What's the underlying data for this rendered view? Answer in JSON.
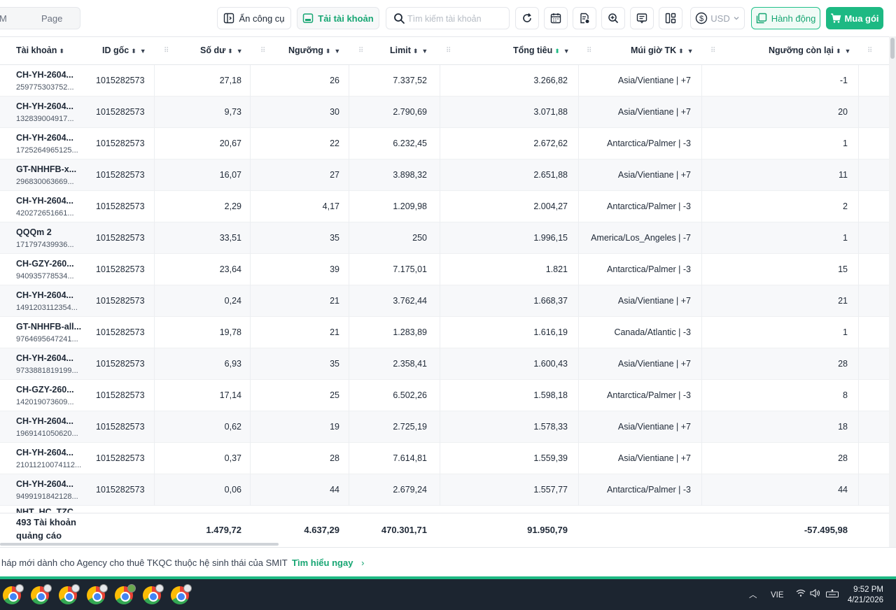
{
  "toolbar": {
    "page_prefix": "M",
    "page_label": "Page",
    "hide_tools_label": "Ẩn công cụ",
    "ad_account_label": "Tải tài khoản",
    "search_placeholder": "Tìm kiếm tài khoản",
    "currency_label": "USD",
    "actions_label": "Hành động",
    "buy_label": "Mua gói",
    "accent_color": "#1db983"
  },
  "table": {
    "columns": [
      "Tài khoản",
      "ID gốc",
      "Số dư",
      "Ngưỡng",
      "Limit",
      "Tổng tiêu",
      "Múi giờ TK",
      "Ngưỡng còn lại"
    ],
    "rows": [
      {
        "name": "CH-YH-2604...",
        "sub": "259775303752...",
        "root_id": "1015282573",
        "balance": "27,18",
        "threshold": "26",
        "limit": "7.337,52",
        "total_spend": "3.266,82",
        "timezone": "Asia/Vientiane | +7",
        "remaining": "-1"
      },
      {
        "name": "CH-YH-2604...",
        "sub": "132839004917...",
        "root_id": "1015282573",
        "balance": "9,73",
        "threshold": "30",
        "limit": "2.790,69",
        "total_spend": "3.071,88",
        "timezone": "Asia/Vientiane | +7",
        "remaining": "20"
      },
      {
        "name": "CH-YH-2604...",
        "sub": "1725264965125...",
        "root_id": "1015282573",
        "balance": "20,67",
        "threshold": "22",
        "limit": "6.232,45",
        "total_spend": "2.672,62",
        "timezone": "Antarctica/Palmer | -3",
        "remaining": "1"
      },
      {
        "name": "GT-NHHFB-x...",
        "sub": "296830063669...",
        "root_id": "1015282573",
        "balance": "16,07",
        "threshold": "27",
        "limit": "3.898,32",
        "total_spend": "2.651,88",
        "timezone": "Asia/Vientiane | +7",
        "remaining": "11"
      },
      {
        "name": "CH-YH-2604...",
        "sub": "420272651661...",
        "root_id": "1015282573",
        "balance": "2,29",
        "threshold": "4,17",
        "limit": "1.209,98",
        "total_spend": "2.004,27",
        "timezone": "Antarctica/Palmer | -3",
        "remaining": "2"
      },
      {
        "name": "QQQm 2",
        "sub": "171797439936...",
        "root_id": "1015282573",
        "balance": "33,51",
        "threshold": "35",
        "limit": "250",
        "total_spend": "1.996,15",
        "timezone": "America/Los_Angeles | -7",
        "remaining": "1"
      },
      {
        "name": "CH-GZY-260...",
        "sub": "940935778534...",
        "root_id": "1015282573",
        "balance": "23,64",
        "threshold": "39",
        "limit": "7.175,01",
        "total_spend": "1.821",
        "timezone": "Antarctica/Palmer | -3",
        "remaining": "15"
      },
      {
        "name": "CH-YH-2604...",
        "sub": "1491203112354...",
        "root_id": "1015282573",
        "balance": "0,24",
        "threshold": "21",
        "limit": "3.762,44",
        "total_spend": "1.668,37",
        "timezone": "Asia/Vientiane | +7",
        "remaining": "21"
      },
      {
        "name": "GT-NHHFB-all...",
        "sub": "9764695647241...",
        "root_id": "1015282573",
        "balance": "19,78",
        "threshold": "21",
        "limit": "1.283,89",
        "total_spend": "1.616,19",
        "timezone": "Canada/Atlantic | -3",
        "remaining": "1"
      },
      {
        "name": "CH-YH-2604...",
        "sub": "9733881819199...",
        "root_id": "1015282573",
        "balance": "6,93",
        "threshold": "35",
        "limit": "2.358,41",
        "total_spend": "1.600,43",
        "timezone": "Asia/Vientiane | +7",
        "remaining": "28"
      },
      {
        "name": "CH-GZY-260...",
        "sub": "142019073609...",
        "root_id": "1015282573",
        "balance": "17,14",
        "threshold": "25",
        "limit": "6.502,26",
        "total_spend": "1.598,18",
        "timezone": "Antarctica/Palmer | -3",
        "remaining": "8"
      },
      {
        "name": "CH-YH-2604...",
        "sub": "1969141050620...",
        "root_id": "1015282573",
        "balance": "0,62",
        "threshold": "19",
        "limit": "2.725,19",
        "total_spend": "1.578,33",
        "timezone": "Asia/Vientiane | +7",
        "remaining": "18"
      },
      {
        "name": "CH-YH-2604...",
        "sub": "21011210074112...",
        "root_id": "1015282573",
        "balance": "0,37",
        "threshold": "28",
        "limit": "7.614,81",
        "total_spend": "1.559,39",
        "timezone": "Asia/Vientiane | +7",
        "remaining": "28"
      },
      {
        "name": "CH-YH-2604...",
        "sub": "9499191842128...",
        "root_id": "1015282573",
        "balance": "0,06",
        "threshold": "44",
        "limit": "2.679,24",
        "total_spend": "1.557,77",
        "timezone": "Antarctica/Palmer | -3",
        "remaining": "44"
      }
    ],
    "partial_row_name": "NHT_HC_TZC...",
    "footer": {
      "count_label": "493 Tài khoản quảng cáo",
      "balance": "1.479,72",
      "threshold": "4.637,29",
      "limit": "470.301,71",
      "total_spend": "91.950,79",
      "remaining": "-57.495,98"
    }
  },
  "banner": {
    "text": "háp mới dành cho Agency cho thuê TKQC thuộc hệ sinh thái của SMIT",
    "link": "Tìm hiểu ngay"
  },
  "taskbar": {
    "lang": "VIE",
    "time": "9:52 PM",
    "date": "4/21/2026"
  }
}
